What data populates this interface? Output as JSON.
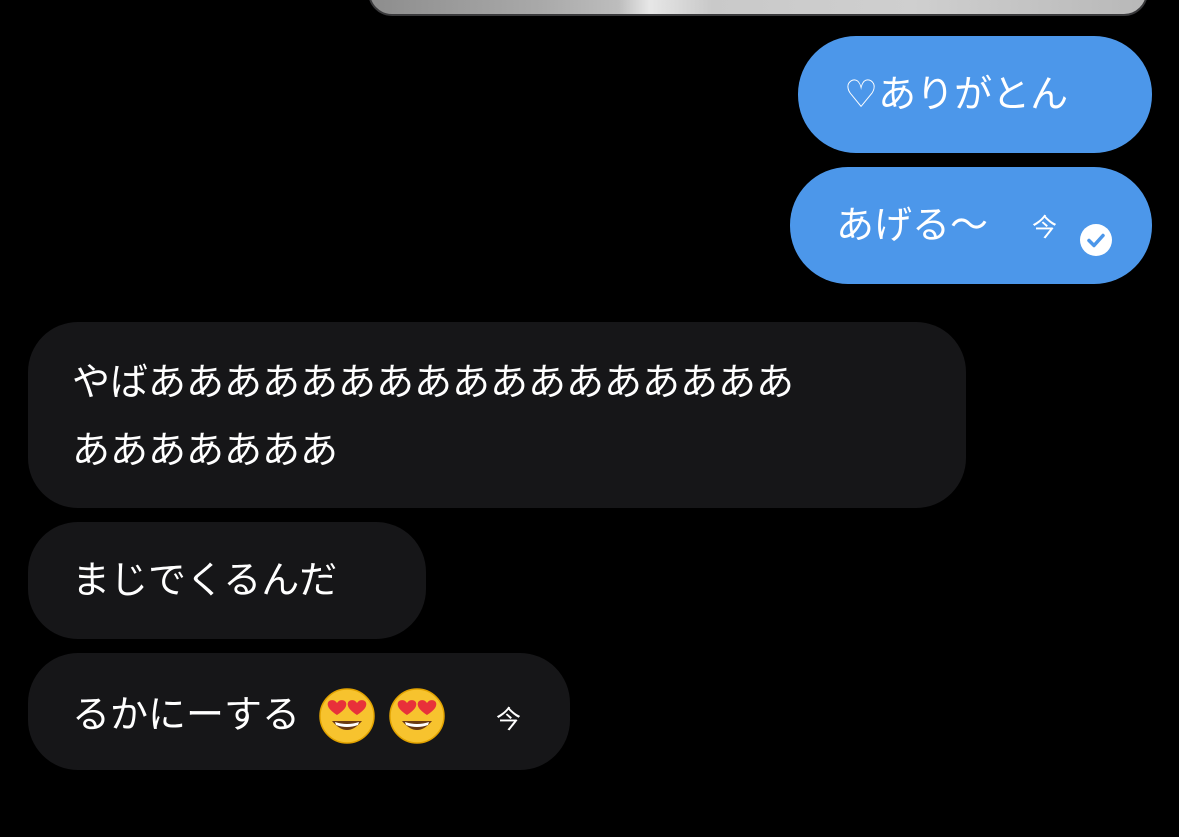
{
  "conversation": {
    "sent_messages": [
      {
        "text": "♡ありがとん"
      },
      {
        "text": "あげる〜",
        "time": "今",
        "read": true
      }
    ],
    "received_messages": [
      {
        "lines": [
          "やばあああああああああああああああああ",
          "あああああああ"
        ]
      },
      {
        "text": "まじでくるんだ"
      },
      {
        "text": "るかにーする",
        "emoji_count": 2,
        "emoji_name": "heart-eyes-emoji",
        "time": "今"
      }
    ]
  },
  "colors": {
    "background": "#000000",
    "sent_bubble": "#4c97ea",
    "received_bubble": "#161618",
    "text": "#ffffff"
  }
}
